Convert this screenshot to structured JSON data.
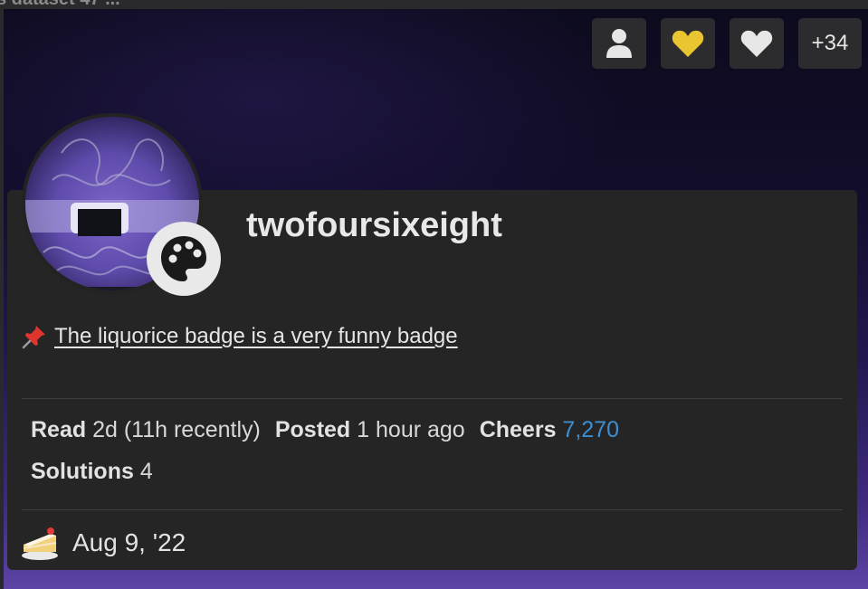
{
  "background_heading": "s dataset 47 ...",
  "badges": [
    {
      "icon": "user-icon"
    },
    {
      "icon": "heart-icon",
      "color": "#e8c531"
    },
    {
      "icon": "heart-icon",
      "color": "#e6e6e6"
    },
    {
      "label": "+34"
    }
  ],
  "user": {
    "username": "twofoursixeight",
    "avatar_icon": "avatar-image",
    "flair_icon": "palette-icon"
  },
  "pinned": {
    "icon": "pushpin-icon",
    "text": "The liquorice badge is a very funny badge"
  },
  "stats": {
    "read_label": "Read",
    "read_value": "2d (11h recently)",
    "posted_label": "Posted",
    "posted_value": "1 hour ago",
    "cheers_label": "Cheers",
    "cheers_value": "7,270",
    "solutions_label": "Solutions",
    "solutions_value": "4"
  },
  "cakeday": {
    "icon": "cake-icon",
    "date": "Aug 9, '22"
  },
  "colors": {
    "accent_link": "#3d8fd1",
    "panel": "#252526",
    "gold_heart": "#e8c531"
  }
}
